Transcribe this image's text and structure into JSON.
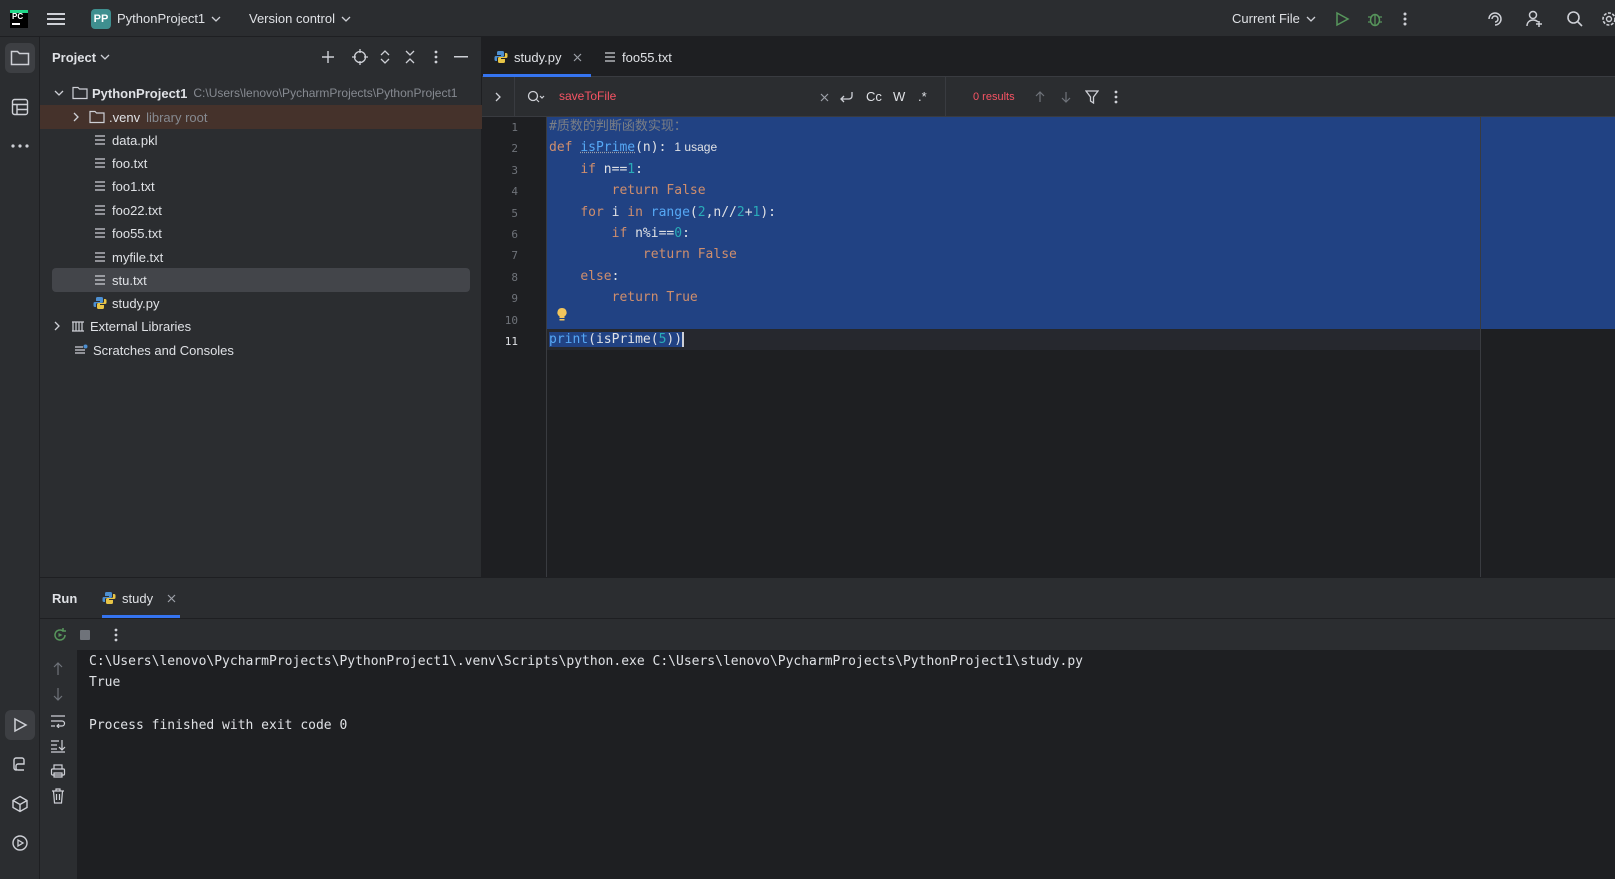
{
  "titlebar": {
    "project_badge": "PP",
    "project_name": "PythonProject1",
    "vcs_label": "Version control",
    "run_config": "Current File"
  },
  "project_panel": {
    "title": "Project",
    "root": {
      "name": "PythonProject1",
      "path": "C:\\Users\\lenovo\\PycharmProjects\\PythonProject1"
    },
    "items": [
      {
        "name": ".venv",
        "suffix": "library root"
      },
      {
        "name": "data.pkl"
      },
      {
        "name": "foo.txt"
      },
      {
        "name": "foo1.txt"
      },
      {
        "name": "foo22.txt"
      },
      {
        "name": "foo55.txt"
      },
      {
        "name": "myfile.txt"
      },
      {
        "name": "stu.txt"
      },
      {
        "name": "study.py"
      },
      {
        "name": "External Libraries"
      },
      {
        "name": "Scratches and Consoles"
      }
    ]
  },
  "editor": {
    "tabs": [
      {
        "label": "study.py"
      },
      {
        "label": "foo55.txt"
      }
    ],
    "find": {
      "query": "saveToFile",
      "results": "0 results",
      "case_label": "Cc",
      "word_label": "W",
      "regex_label": ".*"
    },
    "line_numbers": [
      "1",
      "2",
      "3",
      "4",
      "5",
      "6",
      "7",
      "8",
      "9",
      "10",
      "11"
    ],
    "usage_hint": "1 usage"
  },
  "run_panel": {
    "title": "Run",
    "tab_label": "study",
    "console": {
      "cmd": "C:\\Users\\lenovo\\PycharmProjects\\PythonProject1\\.venv\\Scripts\\python.exe C:\\Users\\lenovo\\PycharmProjects\\PythonProject1\\study.py",
      "output": "True",
      "exit": "Process finished with exit code 0"
    }
  },
  "colors": {
    "accent": "#3574f0",
    "selection": "#214283",
    "run_green": "#57965c",
    "error_red": "#f75464"
  }
}
